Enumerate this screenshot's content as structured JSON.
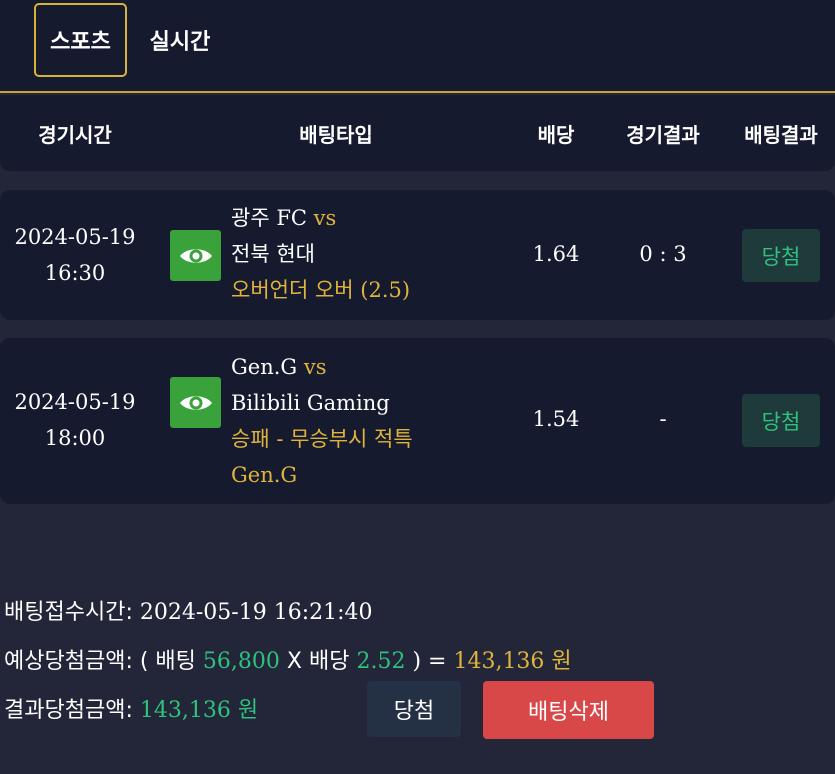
{
  "tabs": [
    {
      "label": "스포츠",
      "active": true
    },
    {
      "label": "실시간",
      "active": false
    }
  ],
  "columns": {
    "time": "경기시간",
    "bet_type": "배팅타입",
    "odds": "배당",
    "game_result": "경기결과",
    "bet_result": "배팅결과"
  },
  "bets": [
    {
      "date": "2024-05-19",
      "time": "16:30",
      "home": "광주 FC",
      "vs": "vs",
      "away": "전북 현대",
      "pick_line1": "오버언더 오버 (2.5)",
      "pick_line2": "",
      "odds": "1.64",
      "score": "0 : 3",
      "result": "당첨"
    },
    {
      "date": "2024-05-19",
      "time": "18:00",
      "home": "Gen.G",
      "vs": "vs",
      "away": "Bilibili Gaming",
      "pick_line1": "승패 - 무승부시 적특",
      "pick_line2": "Gen.G",
      "odds": "1.54",
      "score": "-",
      "result": "당첨"
    }
  ],
  "summary": {
    "received_label": "배팅접수시간:",
    "received_value": "2024-05-19 16:21:40",
    "expected_label": "예상당첨금액:",
    "expected_open": "( 배팅",
    "stake": "56,800",
    "times": "X 배당",
    "total_odds": "2.52",
    "expected_close": ") =",
    "expected_amount": "143,136 원",
    "actual_label": "결과당첨금액:",
    "actual_amount": "143,136 원"
  },
  "buttons": {
    "win": "당첨",
    "delete": "배팅삭제"
  },
  "colors": {
    "background": "#222638",
    "panel": "#151a2e",
    "accent_gold": "#e0b43c",
    "win_green": "#2ec27e",
    "delete_red": "#d94848",
    "eye_green": "#3aa23a"
  }
}
